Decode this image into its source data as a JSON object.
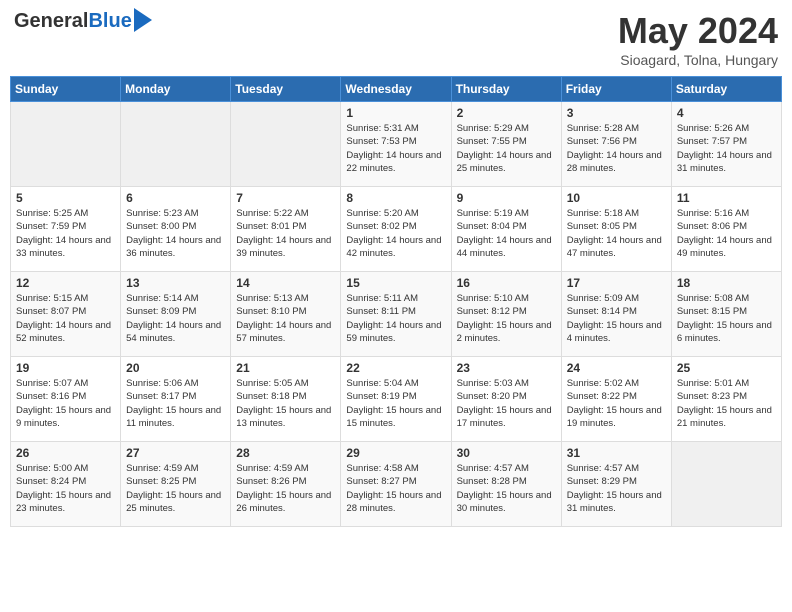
{
  "logo": {
    "general": "General",
    "blue": "Blue"
  },
  "title": "May 2024",
  "location": "Sioagard, Tolna, Hungary",
  "days_header": [
    "Sunday",
    "Monday",
    "Tuesday",
    "Wednesday",
    "Thursday",
    "Friday",
    "Saturday"
  ],
  "weeks": [
    [
      {
        "day": "",
        "sunrise": "",
        "sunset": "",
        "daylight": ""
      },
      {
        "day": "",
        "sunrise": "",
        "sunset": "",
        "daylight": ""
      },
      {
        "day": "",
        "sunrise": "",
        "sunset": "",
        "daylight": ""
      },
      {
        "day": "1",
        "sunrise": "Sunrise: 5:31 AM",
        "sunset": "Sunset: 7:53 PM",
        "daylight": "Daylight: 14 hours and 22 minutes."
      },
      {
        "day": "2",
        "sunrise": "Sunrise: 5:29 AM",
        "sunset": "Sunset: 7:55 PM",
        "daylight": "Daylight: 14 hours and 25 minutes."
      },
      {
        "day": "3",
        "sunrise": "Sunrise: 5:28 AM",
        "sunset": "Sunset: 7:56 PM",
        "daylight": "Daylight: 14 hours and 28 minutes."
      },
      {
        "day": "4",
        "sunrise": "Sunrise: 5:26 AM",
        "sunset": "Sunset: 7:57 PM",
        "daylight": "Daylight: 14 hours and 31 minutes."
      }
    ],
    [
      {
        "day": "5",
        "sunrise": "Sunrise: 5:25 AM",
        "sunset": "Sunset: 7:59 PM",
        "daylight": "Daylight: 14 hours and 33 minutes."
      },
      {
        "day": "6",
        "sunrise": "Sunrise: 5:23 AM",
        "sunset": "Sunset: 8:00 PM",
        "daylight": "Daylight: 14 hours and 36 minutes."
      },
      {
        "day": "7",
        "sunrise": "Sunrise: 5:22 AM",
        "sunset": "Sunset: 8:01 PM",
        "daylight": "Daylight: 14 hours and 39 minutes."
      },
      {
        "day": "8",
        "sunrise": "Sunrise: 5:20 AM",
        "sunset": "Sunset: 8:02 PM",
        "daylight": "Daylight: 14 hours and 42 minutes."
      },
      {
        "day": "9",
        "sunrise": "Sunrise: 5:19 AM",
        "sunset": "Sunset: 8:04 PM",
        "daylight": "Daylight: 14 hours and 44 minutes."
      },
      {
        "day": "10",
        "sunrise": "Sunrise: 5:18 AM",
        "sunset": "Sunset: 8:05 PM",
        "daylight": "Daylight: 14 hours and 47 minutes."
      },
      {
        "day": "11",
        "sunrise": "Sunrise: 5:16 AM",
        "sunset": "Sunset: 8:06 PM",
        "daylight": "Daylight: 14 hours and 49 minutes."
      }
    ],
    [
      {
        "day": "12",
        "sunrise": "Sunrise: 5:15 AM",
        "sunset": "Sunset: 8:07 PM",
        "daylight": "Daylight: 14 hours and 52 minutes."
      },
      {
        "day": "13",
        "sunrise": "Sunrise: 5:14 AM",
        "sunset": "Sunset: 8:09 PM",
        "daylight": "Daylight: 14 hours and 54 minutes."
      },
      {
        "day": "14",
        "sunrise": "Sunrise: 5:13 AM",
        "sunset": "Sunset: 8:10 PM",
        "daylight": "Daylight: 14 hours and 57 minutes."
      },
      {
        "day": "15",
        "sunrise": "Sunrise: 5:11 AM",
        "sunset": "Sunset: 8:11 PM",
        "daylight": "Daylight: 14 hours and 59 minutes."
      },
      {
        "day": "16",
        "sunrise": "Sunrise: 5:10 AM",
        "sunset": "Sunset: 8:12 PM",
        "daylight": "Daylight: 15 hours and 2 minutes."
      },
      {
        "day": "17",
        "sunrise": "Sunrise: 5:09 AM",
        "sunset": "Sunset: 8:14 PM",
        "daylight": "Daylight: 15 hours and 4 minutes."
      },
      {
        "day": "18",
        "sunrise": "Sunrise: 5:08 AM",
        "sunset": "Sunset: 8:15 PM",
        "daylight": "Daylight: 15 hours and 6 minutes."
      }
    ],
    [
      {
        "day": "19",
        "sunrise": "Sunrise: 5:07 AM",
        "sunset": "Sunset: 8:16 PM",
        "daylight": "Daylight: 15 hours and 9 minutes."
      },
      {
        "day": "20",
        "sunrise": "Sunrise: 5:06 AM",
        "sunset": "Sunset: 8:17 PM",
        "daylight": "Daylight: 15 hours and 11 minutes."
      },
      {
        "day": "21",
        "sunrise": "Sunrise: 5:05 AM",
        "sunset": "Sunset: 8:18 PM",
        "daylight": "Daylight: 15 hours and 13 minutes."
      },
      {
        "day": "22",
        "sunrise": "Sunrise: 5:04 AM",
        "sunset": "Sunset: 8:19 PM",
        "daylight": "Daylight: 15 hours and 15 minutes."
      },
      {
        "day": "23",
        "sunrise": "Sunrise: 5:03 AM",
        "sunset": "Sunset: 8:20 PM",
        "daylight": "Daylight: 15 hours and 17 minutes."
      },
      {
        "day": "24",
        "sunrise": "Sunrise: 5:02 AM",
        "sunset": "Sunset: 8:22 PM",
        "daylight": "Daylight: 15 hours and 19 minutes."
      },
      {
        "day": "25",
        "sunrise": "Sunrise: 5:01 AM",
        "sunset": "Sunset: 8:23 PM",
        "daylight": "Daylight: 15 hours and 21 minutes."
      }
    ],
    [
      {
        "day": "26",
        "sunrise": "Sunrise: 5:00 AM",
        "sunset": "Sunset: 8:24 PM",
        "daylight": "Daylight: 15 hours and 23 minutes."
      },
      {
        "day": "27",
        "sunrise": "Sunrise: 4:59 AM",
        "sunset": "Sunset: 8:25 PM",
        "daylight": "Daylight: 15 hours and 25 minutes."
      },
      {
        "day": "28",
        "sunrise": "Sunrise: 4:59 AM",
        "sunset": "Sunset: 8:26 PM",
        "daylight": "Daylight: 15 hours and 26 minutes."
      },
      {
        "day": "29",
        "sunrise": "Sunrise: 4:58 AM",
        "sunset": "Sunset: 8:27 PM",
        "daylight": "Daylight: 15 hours and 28 minutes."
      },
      {
        "day": "30",
        "sunrise": "Sunrise: 4:57 AM",
        "sunset": "Sunset: 8:28 PM",
        "daylight": "Daylight: 15 hours and 30 minutes."
      },
      {
        "day": "31",
        "sunrise": "Sunrise: 4:57 AM",
        "sunset": "Sunset: 8:29 PM",
        "daylight": "Daylight: 15 hours and 31 minutes."
      },
      {
        "day": "",
        "sunrise": "",
        "sunset": "",
        "daylight": ""
      }
    ]
  ]
}
